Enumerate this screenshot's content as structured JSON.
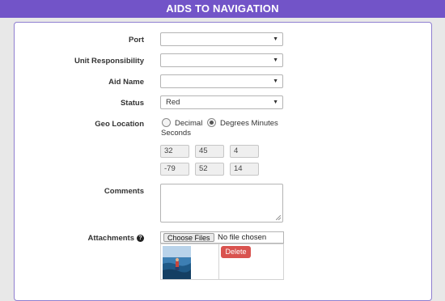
{
  "header": {
    "title": "AIDS TO NAVIGATION"
  },
  "form": {
    "port": {
      "label": "Port",
      "value": ""
    },
    "unit_responsibility": {
      "label": "Unit Responsibility",
      "value": ""
    },
    "aid_name": {
      "label": "Aid Name",
      "value": ""
    },
    "status": {
      "label": "Status",
      "value": "Red"
    },
    "geo_location": {
      "label": "Geo Location",
      "options": [
        "Decimal",
        "Degrees Minutes Seconds"
      ],
      "selected": "Degrees Minutes Seconds",
      "option_decimal": "Decimal",
      "option_dms_line1": "Degrees Minutes",
      "option_dms_line2": "Seconds",
      "latitude": {
        "degrees": "32",
        "minutes": "45",
        "seconds": "4"
      },
      "longitude": {
        "degrees": "-79",
        "minutes": "52",
        "seconds": "14"
      }
    },
    "comments": {
      "label": "Comments",
      "value": ""
    },
    "attachments": {
      "label": "Attachments",
      "help_icon": "question-circle-icon",
      "choose_files_label": "Choose Files",
      "file_status": "No file chosen",
      "delete_label": "Delete"
    }
  },
  "colors": {
    "header_bg": "#7254c8",
    "panel_border": "#8f7fd0",
    "delete_bg": "#d9534f"
  }
}
